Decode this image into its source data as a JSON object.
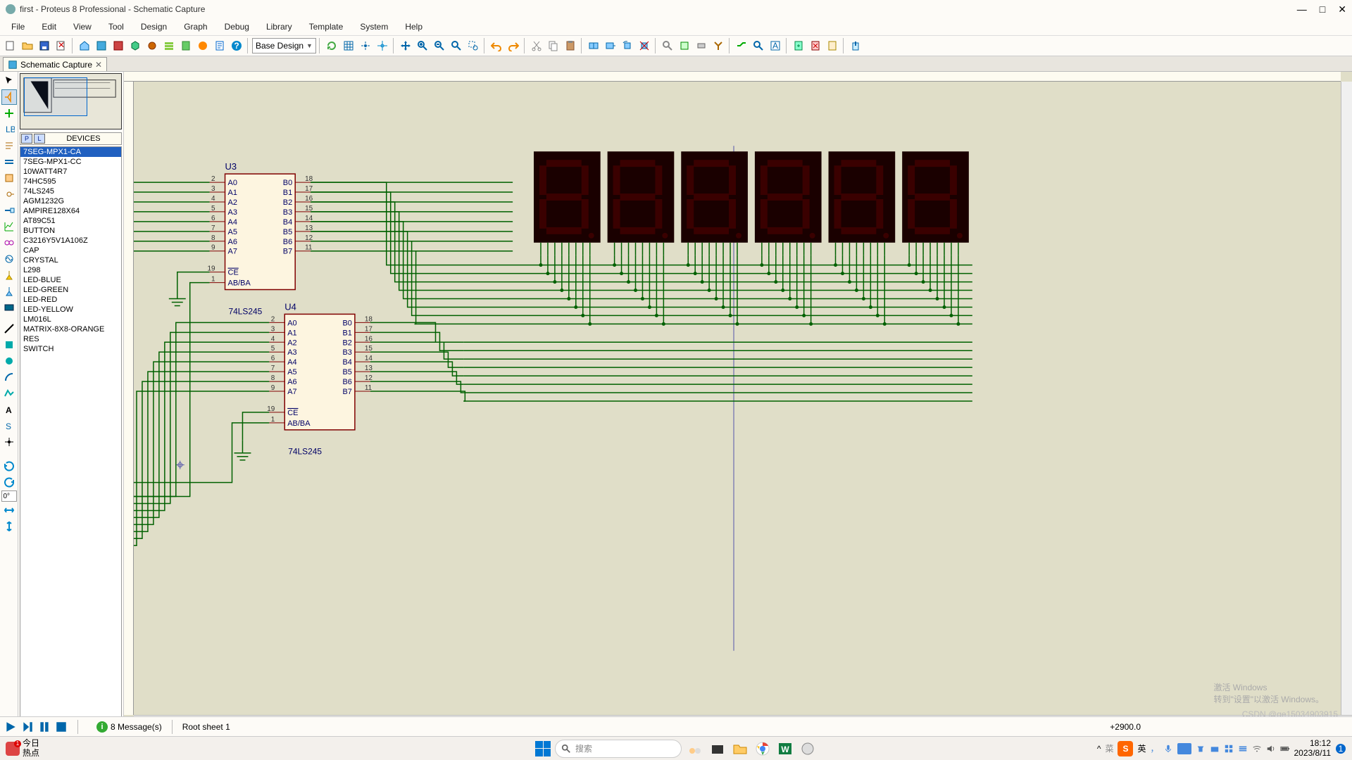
{
  "title": "first - Proteus 8 Professional - Schematic Capture",
  "menus": [
    "File",
    "Edit",
    "View",
    "Tool",
    "Design",
    "Graph",
    "Debug",
    "Library",
    "Template",
    "System",
    "Help"
  ],
  "design_combo": "Base Design",
  "doc_tab": "Schematic Capture",
  "devices_header": "DEVICES",
  "devices": [
    "7SEG-MPX1-CA",
    "7SEG-MPX1-CC",
    "10WATT4R7",
    "74HC595",
    "74LS245",
    "AGM1232G",
    "AMPIRE128X64",
    "AT89C51",
    "BUTTON",
    "C3216Y5V1A106Z",
    "CAP",
    "CRYSTAL",
    "L298",
    "LED-BLUE",
    "LED-GREEN",
    "LED-RED",
    "LED-YELLOW",
    "LM016L",
    "MATRIX-8X8-ORANGE",
    "RES",
    "SWITCH"
  ],
  "selected_device": "7SEG-MPX1-CA",
  "rot_angle": "0°",
  "u3": {
    "ref": "U3",
    "part": "74LS245",
    "a_pins": [
      "A0",
      "A1",
      "A2",
      "A3",
      "A4",
      "A5",
      "A6",
      "A7"
    ],
    "a_nums": [
      "2",
      "3",
      "4",
      "5",
      "6",
      "7",
      "8",
      "9"
    ],
    "b_pins": [
      "B0",
      "B1",
      "B2",
      "B3",
      "B4",
      "B5",
      "B6",
      "B7"
    ],
    "b_nums": [
      "18",
      "17",
      "16",
      "15",
      "14",
      "13",
      "12",
      "11"
    ],
    "ce": "CE",
    "ab": "AB/BA",
    "ce_num": "19",
    "ab_num": "1"
  },
  "u4": {
    "ref": "U4",
    "part": "74LS245",
    "a_pins": [
      "A0",
      "A1",
      "A2",
      "A3",
      "A4",
      "A5",
      "A6",
      "A7"
    ],
    "a_nums": [
      "2",
      "3",
      "4",
      "5",
      "6",
      "7",
      "8",
      "9"
    ],
    "b_pins": [
      "B0",
      "B1",
      "B2",
      "B3",
      "B4",
      "B5",
      "B6",
      "B7"
    ],
    "b_nums": [
      "18",
      "17",
      "16",
      "15",
      "14",
      "13",
      "12",
      "11"
    ],
    "ce": "CE",
    "ab": "AB/BA",
    "ce_num": "19",
    "ab_num": "1"
  },
  "status_messages": "8 Message(s)",
  "status_sheet": "Root sheet 1",
  "status_coord": "+2900.0",
  "watermark1": "激活 Windows",
  "watermark2": "转到\"设置\"以激活 Windows。",
  "csdn": "CSDN @ge15034903915",
  "weather_line1": "今日",
  "weather_line2": "热点",
  "search_placeholder": "搜索",
  "ime_lang": "英",
  "time": "18:12",
  "date": "2023/8/11"
}
